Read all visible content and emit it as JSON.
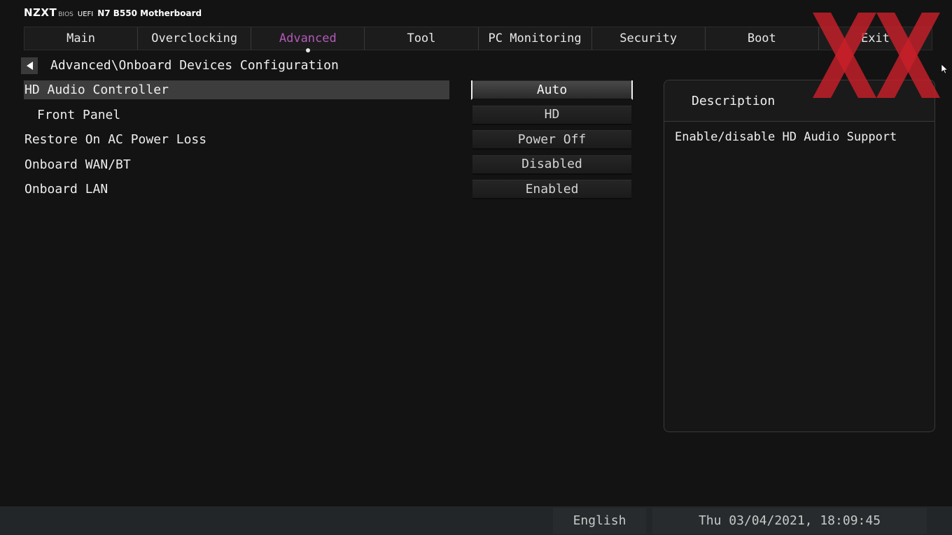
{
  "header": {
    "logo": "NZXT",
    "bios_label": "BIOS",
    "uefi_label": "UEFI",
    "model": "N7 B550 Motherboard"
  },
  "tabs": [
    {
      "label": "Main",
      "active": false
    },
    {
      "label": "Overclocking",
      "active": false
    },
    {
      "label": "Advanced",
      "active": true
    },
    {
      "label": "Tool",
      "active": false
    },
    {
      "label": "PC Monitoring",
      "active": false
    },
    {
      "label": "Security",
      "active": false
    },
    {
      "label": "Boot",
      "active": false
    },
    {
      "label": "Exit",
      "active": false
    }
  ],
  "breadcrumb": "Advanced\\Onboard Devices Configuration",
  "settings": [
    {
      "label": "HD Audio Controller",
      "value": "Auto",
      "selected": true,
      "indent": false
    },
    {
      "label": "Front Panel",
      "value": "HD",
      "selected": false,
      "indent": true
    },
    {
      "label": "Restore On AC Power Loss",
      "value": "Power Off",
      "selected": false,
      "indent": false
    },
    {
      "label": "Onboard WAN/BT",
      "value": "Disabled",
      "selected": false,
      "indent": false
    },
    {
      "label": "Onboard LAN",
      "value": "Enabled",
      "selected": false,
      "indent": false
    }
  ],
  "description": {
    "title": "Description",
    "text": "Enable/disable HD Audio Support"
  },
  "footer": {
    "language": "English",
    "datetime": "Thu 03/04/2021, 18:09:45"
  },
  "colors": {
    "background": "#131313",
    "active_tab": "#b35ab8",
    "watermark": "#c8202a"
  },
  "icons": {
    "back": "back-arrow-icon",
    "watermark": "xx-watermark-logo",
    "cursor": "mouse-cursor-icon"
  }
}
